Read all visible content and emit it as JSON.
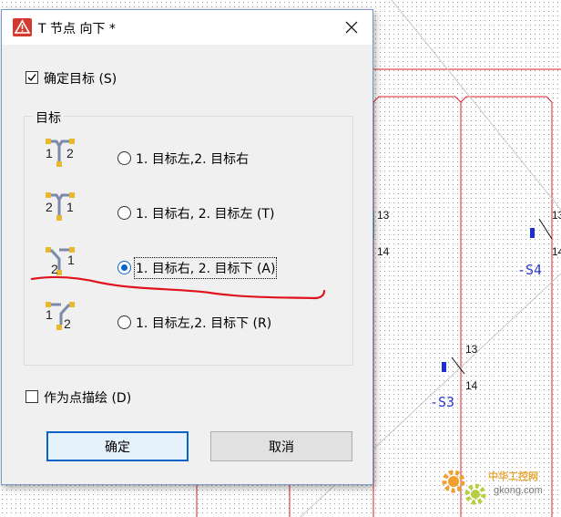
{
  "dialog": {
    "title": "T 节点 向下 *",
    "confirm_target": {
      "label": "确定目标 (S)",
      "checked": true
    },
    "group_title": "目标",
    "options": [
      {
        "label": "1. 目标左,2. 目标右",
        "selected": false,
        "icon": "t-junction-left-right-icon"
      },
      {
        "label": "1. 目标右, 2. 目标左 (T)",
        "selected": false,
        "icon": "t-junction-right-left-icon"
      },
      {
        "label": "1. 目标右, 2. 目标下 (A)",
        "selected": true,
        "icon": "t-junction-right-down-icon"
      },
      {
        "label": "1. 目标左,2. 目标下 (R)",
        "selected": false,
        "icon": "t-junction-left-down-icon"
      }
    ],
    "draw_as_point": {
      "label": "作为点描绘 (D)",
      "checked": false
    },
    "ok_label": "确定",
    "cancel_label": "取消"
  },
  "cad": {
    "labels": {
      "n13a": "13",
      "n14a": "14",
      "n13b": "13",
      "n14b": "14",
      "n13c": "13",
      "n14c": "14"
    },
    "tags": {
      "s4": "-S4",
      "s3": "-S3"
    }
  },
  "watermark": {
    "line1": "中华工控网",
    "line2": "gkong.com"
  },
  "colors": {
    "wire": "#d8202a",
    "selection": "#0a64c8",
    "tag": "#2a3bd0",
    "annotation": "#e0141e"
  }
}
